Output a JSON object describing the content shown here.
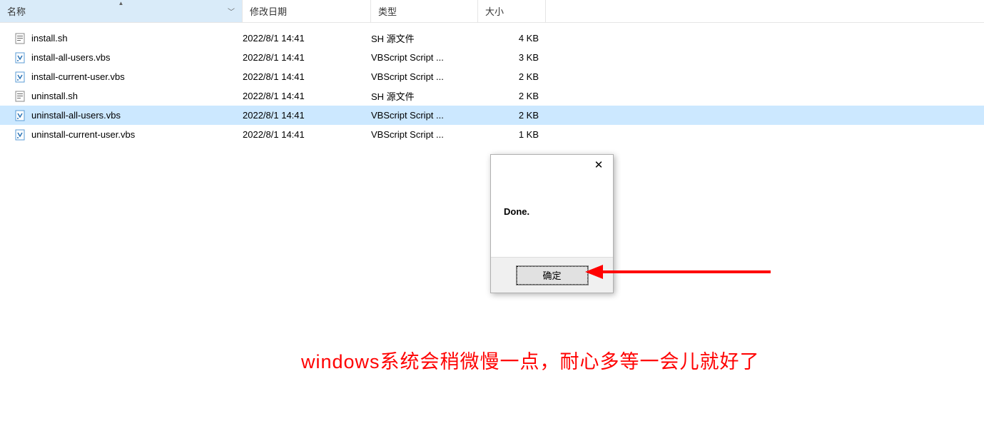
{
  "columns": {
    "name": "名称",
    "date": "修改日期",
    "type": "类型",
    "size": "大小"
  },
  "files": [
    {
      "name": "install.sh",
      "date": "2022/8/1 14:41",
      "type": "SH 源文件",
      "size": "4 KB",
      "icon": "sh",
      "selected": false
    },
    {
      "name": "install-all-users.vbs",
      "date": "2022/8/1 14:41",
      "type": "VBScript Script ...",
      "size": "3 KB",
      "icon": "vbs",
      "selected": false
    },
    {
      "name": "install-current-user.vbs",
      "date": "2022/8/1 14:41",
      "type": "VBScript Script ...",
      "size": "2 KB",
      "icon": "vbs",
      "selected": false
    },
    {
      "name": "uninstall.sh",
      "date": "2022/8/1 14:41",
      "type": "SH 源文件",
      "size": "2 KB",
      "icon": "sh",
      "selected": false
    },
    {
      "name": "uninstall-all-users.vbs",
      "date": "2022/8/1 14:41",
      "type": "VBScript Script ...",
      "size": "2 KB",
      "icon": "vbs",
      "selected": true
    },
    {
      "name": "uninstall-current-user.vbs",
      "date": "2022/8/1 14:41",
      "type": "VBScript Script ...",
      "size": "1 KB",
      "icon": "vbs",
      "selected": false
    }
  ],
  "dialog": {
    "message": "Done.",
    "ok": "确定"
  },
  "caption": "windows系统会稍微慢一点，耐心多等一会儿就好了"
}
